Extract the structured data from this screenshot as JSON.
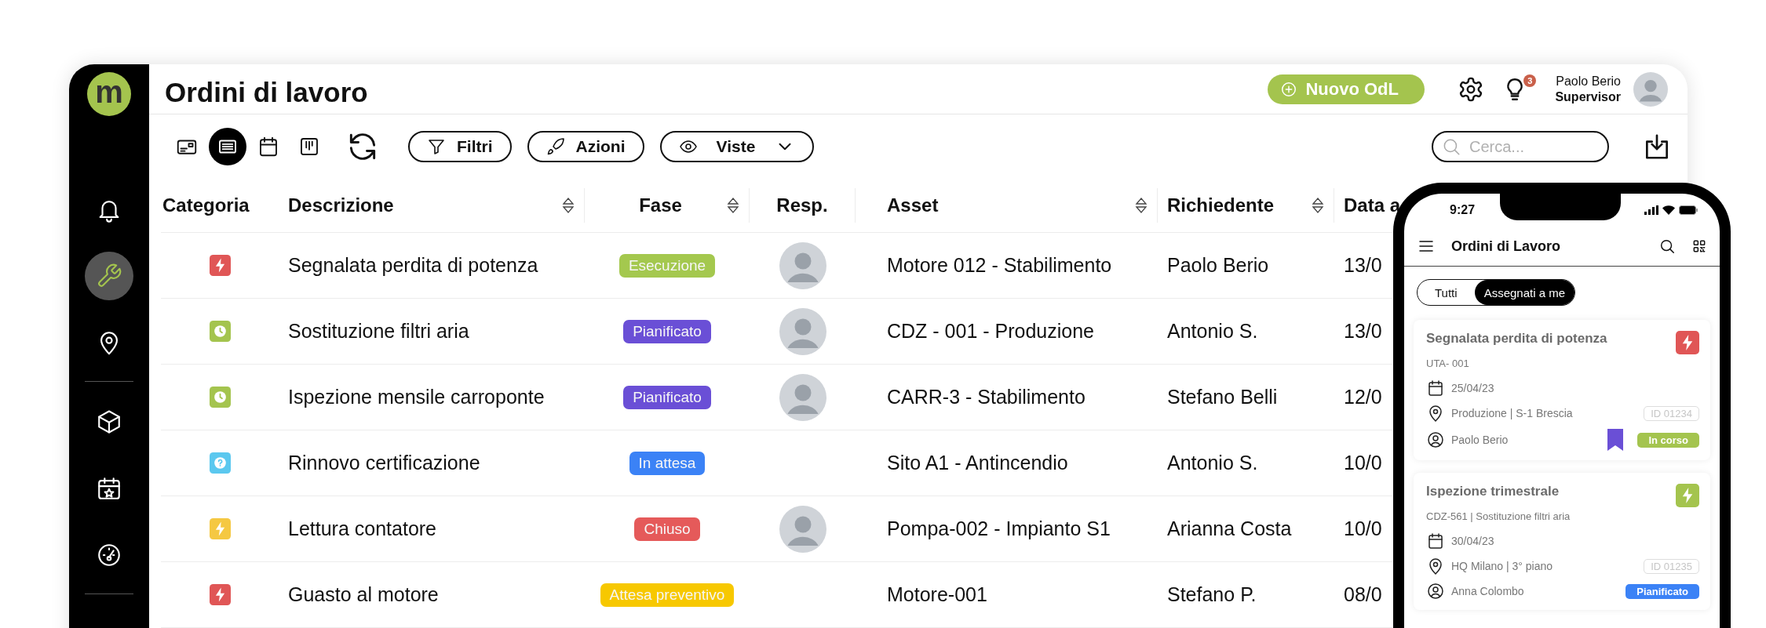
{
  "sidebar": {
    "logo": "m",
    "groups": [
      {
        "items": [
          {
            "kind": "bell",
            "selected": false
          },
          {
            "kind": "wrench",
            "selected": true
          },
          {
            "kind": "pin",
            "selected": false
          }
        ]
      },
      {
        "items": [
          {
            "kind": "cube",
            "selected": false
          },
          {
            "kind": "calendar-star",
            "selected": false
          },
          {
            "kind": "gauge",
            "selected": false
          }
        ]
      }
    ]
  },
  "header": {
    "title": "Ordini di lavoro",
    "new_button": "Nuovo OdL",
    "notifications_badge": "3",
    "user": {
      "name": "Paolo Berio",
      "role": "Supervisor"
    }
  },
  "toolbar": {
    "views": [
      {
        "kind": "card",
        "selected": false
      },
      {
        "kind": "list",
        "selected": true
      },
      {
        "kind": "calendar",
        "selected": false
      },
      {
        "kind": "kanban",
        "selected": false
      }
    ],
    "buttons": [
      {
        "kind": "filter",
        "label": "Filtri"
      },
      {
        "kind": "actions",
        "label": "Azioni"
      },
      {
        "kind": "views",
        "label": "Viste"
      }
    ],
    "search": {
      "placeholder": "Cerca..."
    }
  },
  "table": {
    "columns": [
      {
        "label": "Categoria",
        "sortable": false
      },
      {
        "label": "Descrizione",
        "sortable": true
      },
      {
        "label": "Fase",
        "sortable": true
      },
      {
        "label": "Resp.",
        "sortable": false
      },
      {
        "label": "Asset",
        "sortable": true
      },
      {
        "label": "Richiedente",
        "sortable": true
      },
      {
        "label": "Data a",
        "sortable": false
      }
    ],
    "rows": [
      {
        "category": {
          "kind": "bolt",
          "color": "#e05656"
        },
        "description": "Segnalata perdita di potenza",
        "phase": {
          "label": "Esecuzione",
          "color": "#a4c84e"
        },
        "resp_photo": true,
        "asset": "Motore 012 - Stabilimento",
        "requester": "Paolo Berio",
        "date": "13/0"
      },
      {
        "category": {
          "kind": "clock",
          "color": "#a4c44e"
        },
        "description": "Sostituzione filtri aria",
        "phase": {
          "label": "Pianificato",
          "color": "#6a4fd6"
        },
        "resp_photo": true,
        "asset": "CDZ - 001 - Produzione",
        "requester": "Antonio S.",
        "date": "13/0"
      },
      {
        "category": {
          "kind": "clock",
          "color": "#a4c44e"
        },
        "description": "Ispezione mensile carroponte",
        "phase": {
          "label": "Pianificato",
          "color": "#6a4fd6"
        },
        "resp_photo": true,
        "asset": "CARR-3 - Stabilimento",
        "requester": "Stefano Belli",
        "date": "12/0"
      },
      {
        "category": {
          "kind": "question",
          "color": "#5bc8ef"
        },
        "description": "Rinnovo certificazione",
        "phase": {
          "label": "In attesa",
          "color": "#3b82f6"
        },
        "resp_photo": false,
        "asset": "Sito A1 - Antincendio",
        "requester": "Antonio S.",
        "date": "10/0"
      },
      {
        "category": {
          "kind": "bolt",
          "color": "#f5c842"
        },
        "description": "Lettura contatore",
        "phase": {
          "label": "Chiuso",
          "color": "#e55a5a"
        },
        "resp_photo": true,
        "asset": "Pompa-002 - Impianto S1",
        "requester": "Arianna Costa",
        "date": "10/0"
      },
      {
        "category": {
          "kind": "bolt",
          "color": "#e05656"
        },
        "description": "Guasto al motore",
        "phase": {
          "label": "Attesa preventivo",
          "color": "#f7c800"
        },
        "resp_photo": false,
        "asset": "Motore-001",
        "requester": "Stefano P.",
        "date": "08/0"
      }
    ]
  },
  "phone": {
    "time": "9:27",
    "title": "Ordini di Lavoro",
    "tabs": [
      {
        "label": "Tutti",
        "selected": false
      },
      {
        "label": "Assegnati a me",
        "selected": true
      }
    ],
    "cards": [
      {
        "title": "Segnalata perdita di potenza",
        "subtitle": "UTA- 001",
        "category": {
          "kind": "bolt",
          "color": "#e05656"
        },
        "date": "25/04/23",
        "location": "Produzione | S-1 Brescia",
        "person": "Paolo Berio",
        "id": "ID 01234",
        "bookmarked": true,
        "status": {
          "label": "In corso",
          "color": "#a4c44e"
        }
      },
      {
        "title": "Ispezione trimestrale",
        "subtitle": "CDZ-561 | Sostituzione filtri aria",
        "category": {
          "kind": "bolt",
          "color": "#a4c44e"
        },
        "date": "30/04/23",
        "location": "HQ Milano | 3° piano",
        "person": "Anna Colombo",
        "id": "ID 01235",
        "bookmarked": false,
        "status": {
          "label": "Pianificato",
          "color": "#3b82f6"
        }
      }
    ]
  }
}
